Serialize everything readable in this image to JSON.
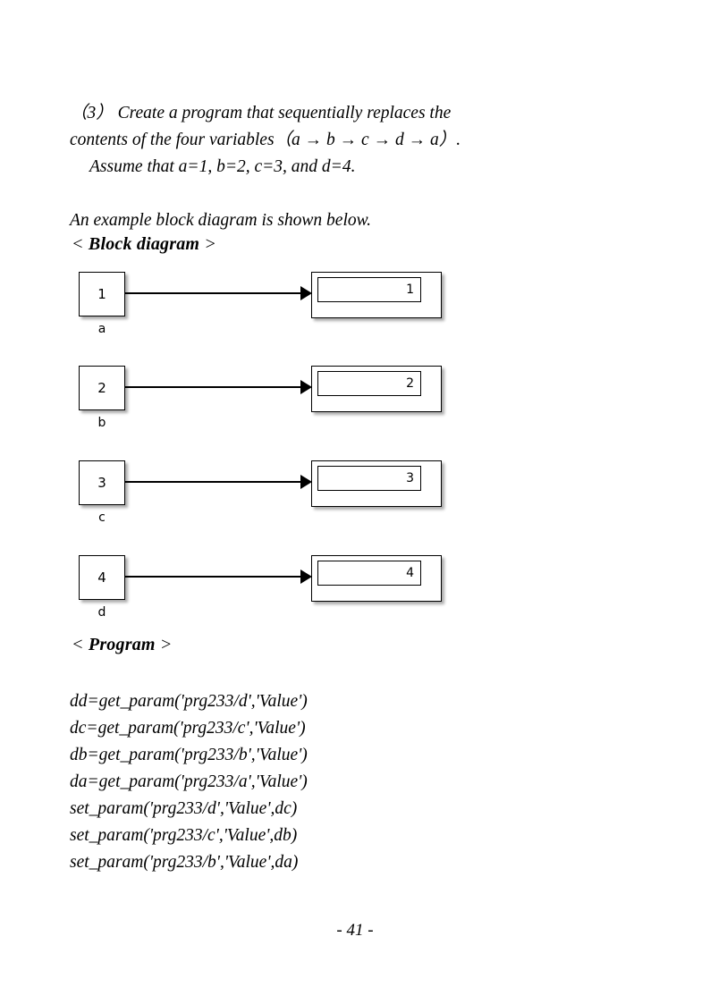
{
  "document": {
    "question": {
      "number": "（3）",
      "line1": "Create a program that sequentially replaces the",
      "line2": "contents of the four variables（a → b → c → d → a）.",
      "assume": "Assume that a=1, b=2, c=3, and d=4."
    },
    "example_note": "An example block diagram is shown below.",
    "headings": {
      "block_diagram": "Block diagram",
      "program": "Program",
      "angle_open": "<",
      "angle_close": ">"
    },
    "block_diagram": {
      "rows": [
        {
          "const_value": "1",
          "label": "a",
          "display_value": "1"
        },
        {
          "const_value": "2",
          "label": "b",
          "display_value": "2"
        },
        {
          "const_value": "3",
          "label": "c",
          "display_value": "3"
        },
        {
          "const_value": "4",
          "label": "d",
          "display_value": "4"
        }
      ]
    },
    "program": {
      "lines": [
        "dd=get_param('prg233/d','Value')",
        "dc=get_param('prg233/c','Value')",
        "db=get_param('prg233/b','Value')",
        "da=get_param('prg233/a','Value')",
        "set_param('prg233/d','Value',dc)",
        "set_param('prg233/c','Value',db)",
        "set_param('prg233/b','Value',da)"
      ]
    },
    "footer": {
      "page_number": "- 41 -"
    }
  }
}
